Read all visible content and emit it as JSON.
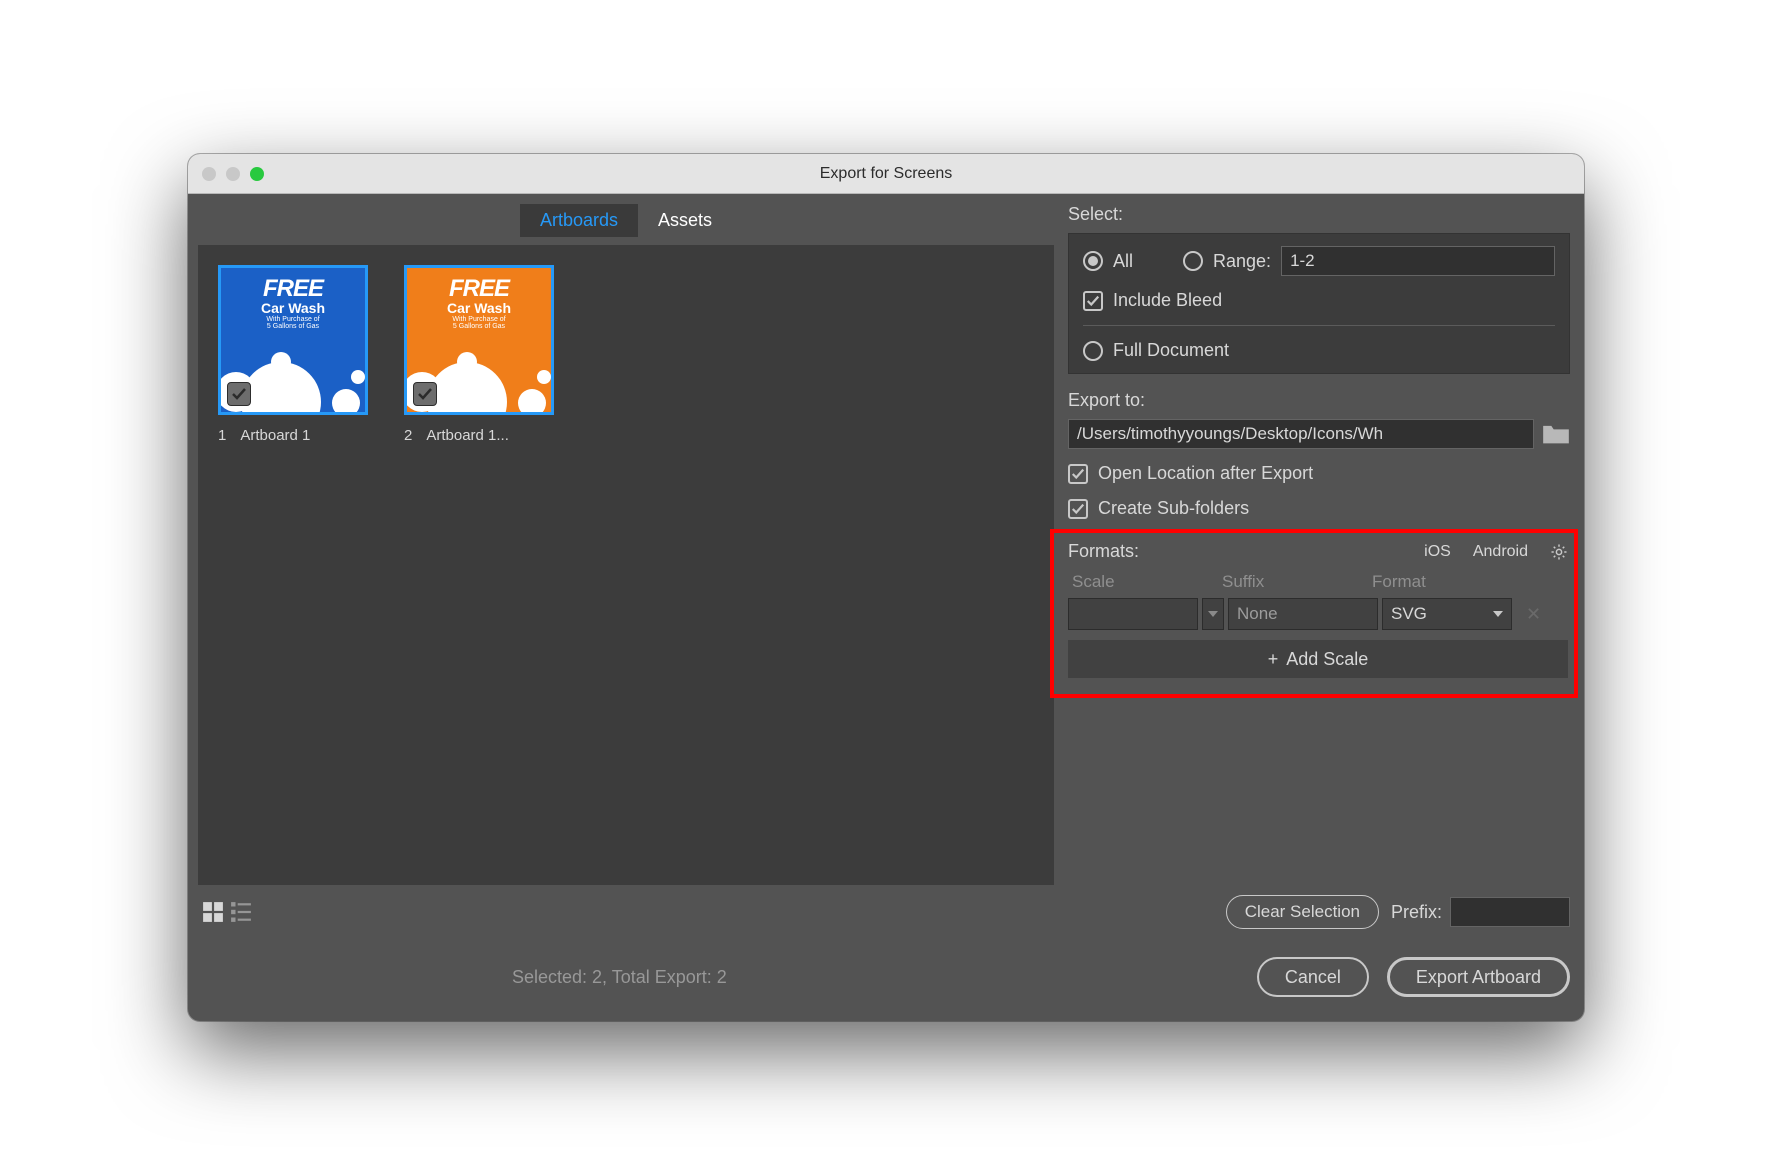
{
  "window": {
    "title": "Export for Screens"
  },
  "tabs": {
    "artboards": "Artboards",
    "assets": "Assets"
  },
  "artboards": [
    {
      "index": "1",
      "name": "Artboard 1",
      "bg": "#1b60c6",
      "checked": true
    },
    {
      "index": "2",
      "name": "Artboard 1...",
      "bg": "#f07e1a",
      "checked": true
    }
  ],
  "select": {
    "label": "Select:",
    "all_label": "All",
    "range_label": "Range:",
    "range_value": "1-2",
    "include_bleed_label": "Include Bleed",
    "full_document_label": "Full Document"
  },
  "export_to": {
    "label": "Export to:",
    "path": "/Users/timothyyoungs/Desktop/Icons/Wh",
    "open_location_label": "Open Location after Export",
    "create_subfolders_label": "Create Sub-folders"
  },
  "formats": {
    "label": "Formats:",
    "ios": "iOS",
    "android": "Android",
    "head_scale": "Scale",
    "head_suffix": "Suffix",
    "head_format": "Format",
    "rows": [
      {
        "scale": "",
        "suffix": "None",
        "format": "SVG"
      }
    ],
    "add_scale_label": "Add Scale"
  },
  "footer": {
    "clear_selection": "Clear Selection",
    "prefix_label": "Prefix:",
    "prefix_value": "",
    "status": "Selected: 2, Total Export: 2",
    "cancel": "Cancel",
    "export": "Export Artboard"
  }
}
